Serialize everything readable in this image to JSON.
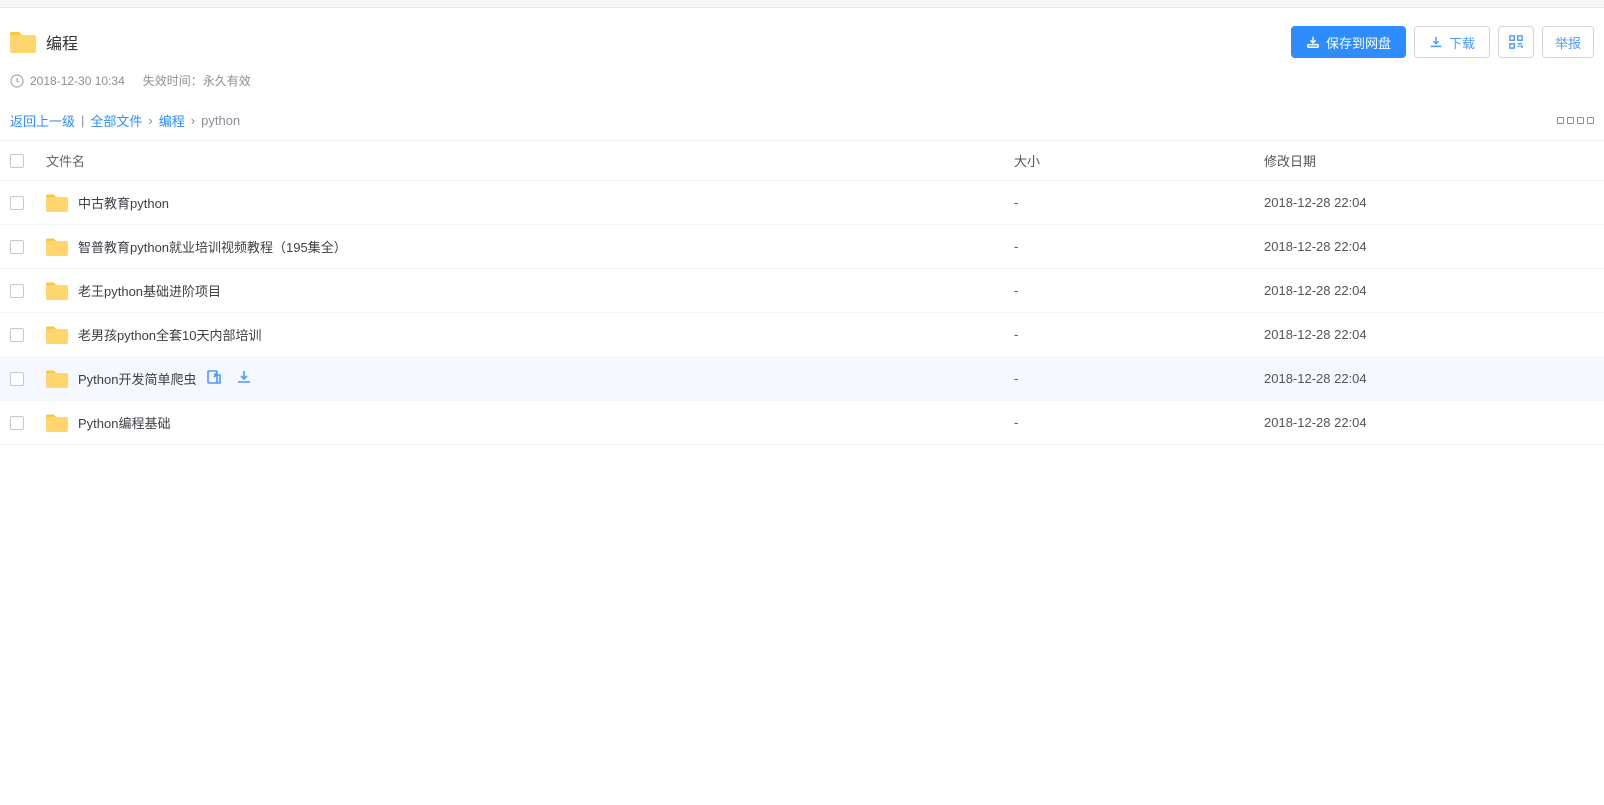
{
  "header": {
    "title": "编程",
    "save_label": "保存到网盘",
    "download_label": "下载",
    "report_label": "举报"
  },
  "meta": {
    "datetime": "2018-12-30 10:34",
    "expiry_label": "失效时间：永久有效"
  },
  "breadcrumbs": {
    "back_label": "返回上一级",
    "all_files_label": "全部文件",
    "folder_label": "编程",
    "current": "python"
  },
  "table": {
    "col_name": "文件名",
    "col_size": "大小",
    "col_date": "修改日期"
  },
  "files": [
    {
      "name": "中古教育python",
      "size": "-",
      "date": "2018-12-28 22:04",
      "hovered": false
    },
    {
      "name": "智普教育python就业培训视频教程（195集全）",
      "size": "-",
      "date": "2018-12-28 22:04",
      "hovered": false
    },
    {
      "name": "老王python基础进阶项目",
      "size": "-",
      "date": "2018-12-28 22:04",
      "hovered": false
    },
    {
      "name": "老男孩python全套10天内部培训",
      "size": "-",
      "date": "2018-12-28 22:04",
      "hovered": false
    },
    {
      "name": "Python开发简单爬虫",
      "size": "-",
      "date": "2018-12-28 22:04",
      "hovered": true
    },
    {
      "name": "Python编程基础",
      "size": "-",
      "date": "2018-12-28 22:04",
      "hovered": false
    }
  ]
}
